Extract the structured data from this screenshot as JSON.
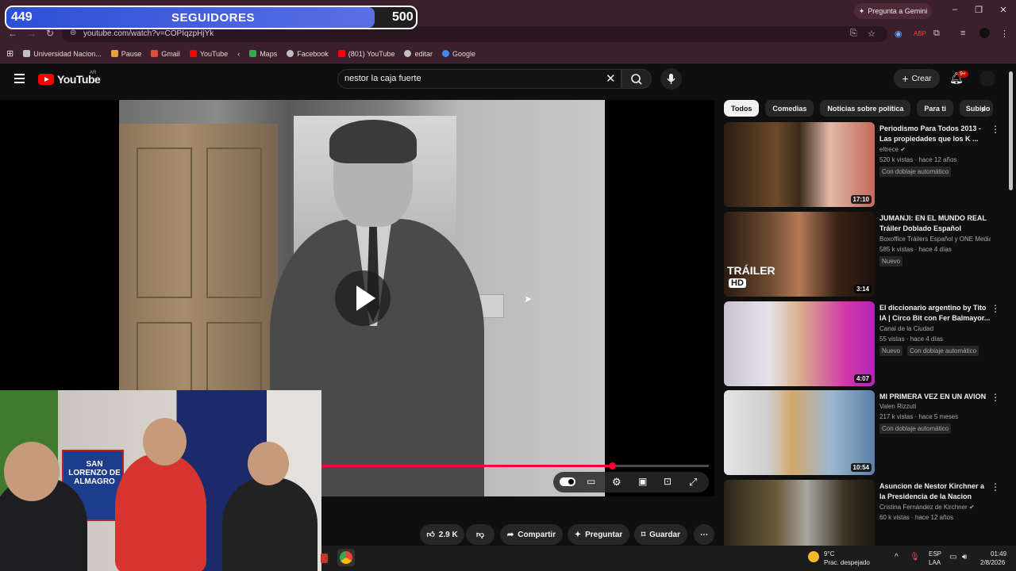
{
  "overlay": {
    "followers_current": "449",
    "followers_label": "SEGUIDORES",
    "followers_goal": "500",
    "progress": 0.9
  },
  "browser": {
    "gemini_label": "Pregunta a Gemini",
    "url": "youtube.com/watch?v=COPIqzpHjYk",
    "bookmarks": [
      "Universidad Nacion...",
      "Pause",
      "Gmail",
      "YouTube",
      "Maps",
      "Facebook",
      "(801) YouTube",
      "editar",
      "Google"
    ],
    "bookmark_colors": [
      "#e3d6db",
      "#e8a23a",
      "#e04b3a",
      "#ff0000",
      "#34a853",
      "#c0c0c0",
      "#ff0000",
      "#c0c0c0",
      "#4285f4"
    ]
  },
  "youtube": {
    "logo_text": "YouTube",
    "country": "AR",
    "search_query": "nestor la caja fuerte",
    "create_label": "Crear",
    "notif_count": "9+"
  },
  "player": {
    "progress": 0.75
  },
  "actions": {
    "likes": "2.9 K",
    "share": "Compartir",
    "ask": "Preguntar",
    "save": "Guardar"
  },
  "chips": [
    "Todos",
    "Comedias",
    "Noticias sobre política",
    "Para ti",
    "Subido"
  ],
  "recommendations": [
    {
      "title": "Periodismo Para Todos 2013 - Las propiedades que los K ...",
      "channel": "eltrece",
      "verified": true,
      "meta": "520 k vistas · hace 12 años",
      "badge": "Con doblaje automático",
      "duration": "17:10"
    },
    {
      "title": "JUMANJI: EN EL MUNDO REAL Tráiler Doblado Español Latino...",
      "channel": "Boxoffice Tráilers Español y ONE Media ...",
      "verified": false,
      "meta": "585 k vistas · hace 4 días",
      "badge": "Nuevo",
      "duration": "3:14",
      "thumb_text": "TRÁILER",
      "thumb_badge": "HD"
    },
    {
      "title": "El diccionario argentino by Tito IA | Circo Bit con Fer Balmayor...",
      "channel": "Canal de la Ciudad",
      "verified": false,
      "meta": "55 vistas · hace 4 días",
      "badge": "Nuevo",
      "badge2": "Con doblaje automático",
      "duration": "4:07"
    },
    {
      "title": "MI PRIMERA VEZ EN UN AVION",
      "channel": "Valen Rizzuti",
      "verified": false,
      "meta": "217 k vistas · hace 5 meses",
      "badge": "Con doblaje automático",
      "duration": "10:54"
    },
    {
      "title": "Asuncion de Nestor Kirchner a la Presidencia de la Nacion",
      "channel": "Cristina Fernández de Kirchner",
      "verified": true,
      "meta": "60 k vistas · hace 12 años",
      "duration": ""
    }
  ],
  "webcam": {
    "flag_text": "SAN LORENZO DE ALMAGRO"
  },
  "taskbar": {
    "temp": "9°C",
    "weather": "Prac. despejado",
    "lang1": "ESP",
    "lang2": "LAA",
    "time": "01:49",
    "date": "2/8/2026"
  }
}
